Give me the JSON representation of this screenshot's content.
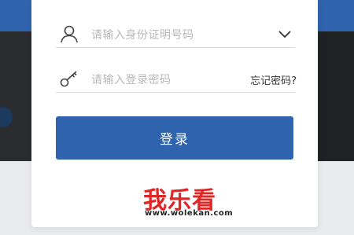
{
  "form": {
    "id_field": {
      "placeholder": "请输入身份证明号码",
      "icon": "user-icon",
      "dropdown_icon": "chevron-down-icon"
    },
    "password_field": {
      "placeholder": "请输入登录密码",
      "icon": "key-icon",
      "forgot_label": "忘记密码?"
    },
    "login_button_label": "登录"
  },
  "watermark": {
    "title": "我乐看",
    "url": "www.wolekan.com"
  },
  "colors": {
    "accent": "#2f63ad",
    "placeholder": "#b9b9b9",
    "watermark": "#e02525"
  }
}
